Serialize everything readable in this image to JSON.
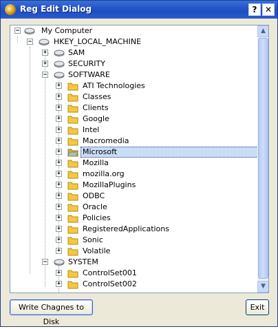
{
  "window": {
    "title": "Reg Edit Dialog",
    "help_glyph": "?",
    "close_glyph": "✕"
  },
  "tree": {
    "root": "My Computer",
    "hive": "HKEY_LOCAL_MACHINE",
    "nodes": [
      "SAM",
      "SECURITY",
      "SOFTWARE",
      "ATI Technologies",
      "Classes",
      "Clients",
      "Google",
      "Intel",
      "Macromedia",
      "Microsoft",
      "Mozilla",
      "mozilla.org",
      "MozillaPlugins",
      "ODBC",
      "Oracle",
      "Policies",
      "RegisteredApplications",
      "Sonic",
      "Volatile",
      "SYSTEM",
      "ControlSet001",
      "ControlSet002"
    ],
    "selected": "Microsoft"
  },
  "buttons": {
    "write_label": "Write Chagnes to Disk",
    "exit_label": "Exit"
  },
  "scrollbar": {
    "up_glyph": "▲",
    "down_glyph": "▼"
  },
  "colors": {
    "title_bar": "#2556c7",
    "selection": "#c9ddf6",
    "folder": "#f5c842"
  }
}
